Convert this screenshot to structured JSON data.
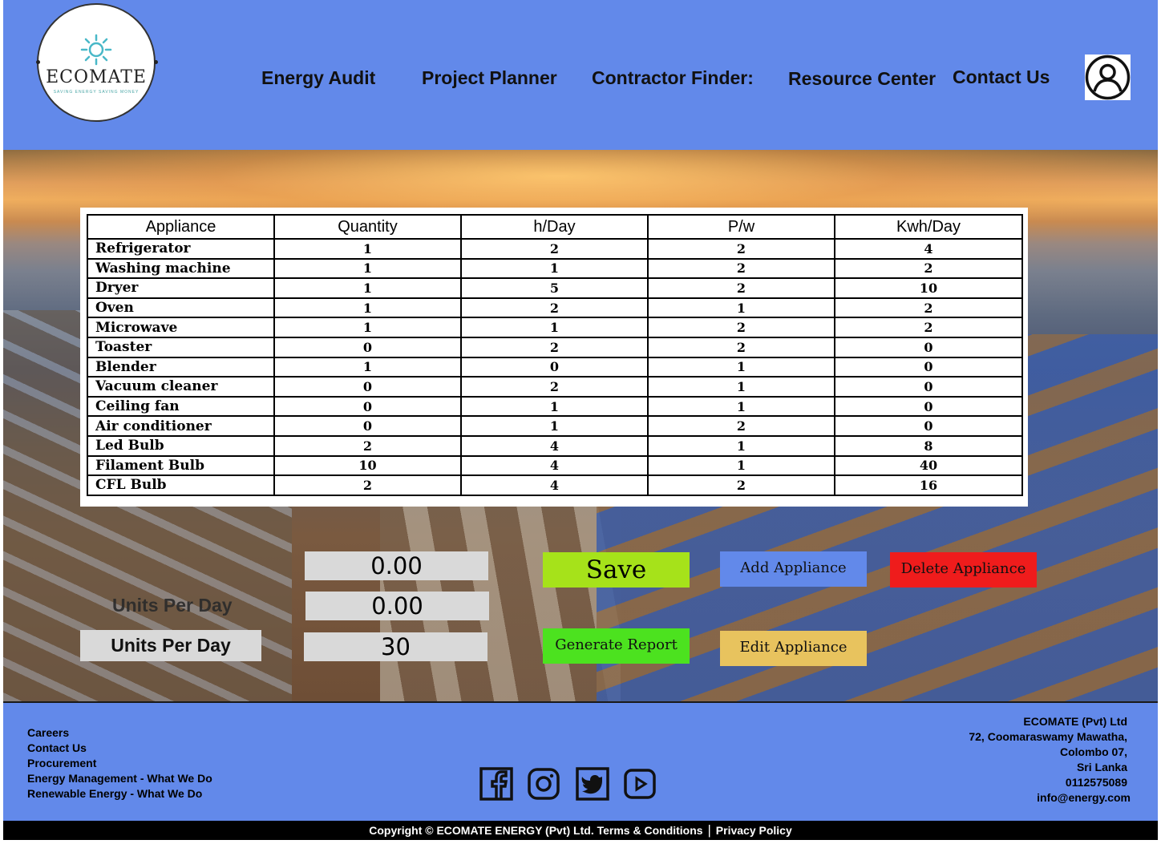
{
  "logo": {
    "brand": "ECOMATE",
    "tagline": "SAVING ENERGY SAVING MONEY"
  },
  "nav": {
    "energy_audit": "Energy Audit",
    "project_planner": "Project Planner",
    "contractor_finder": "Contractor Finder:",
    "resource_center": "Resource Center",
    "contact_us": "Contact Us"
  },
  "table": {
    "headers": [
      "Appliance",
      "Quantity",
      "h/Day",
      "P/w",
      "Kwh/Day"
    ],
    "rows": [
      [
        "Refrigerator",
        "1",
        "2",
        "2",
        "4"
      ],
      [
        "Washing machine",
        "1",
        "1",
        "2",
        "2"
      ],
      [
        "Dryer",
        "1",
        "5",
        "2",
        "10"
      ],
      [
        "Oven",
        "1",
        "2",
        "1",
        "2"
      ],
      [
        "Microwave",
        "1",
        "1",
        "2",
        "2"
      ],
      [
        "Toaster",
        "0",
        "2",
        "2",
        "0"
      ],
      [
        "Blender",
        "1",
        "0",
        "1",
        "0"
      ],
      [
        "Vacuum cleaner",
        "0",
        "2",
        "1",
        "0"
      ],
      [
        "Ceiling fan",
        "0",
        "1",
        "1",
        "0"
      ],
      [
        "Air conditioner",
        "0",
        "1",
        "2",
        "0"
      ],
      [
        "Led Bulb",
        "2",
        "4",
        "1",
        "8"
      ],
      [
        "Filament Bulb",
        "10",
        "4",
        "1",
        "40"
      ],
      [
        "CFL Bulb",
        "2",
        "4",
        "2",
        "16"
      ]
    ]
  },
  "controls": {
    "field1": "0.00",
    "field2": "0.00",
    "field3": "30",
    "ghost_label": "Units Per Day",
    "units_label": "Units Per Day",
    "save": "Save",
    "add_appliance": "Add Appliance",
    "delete_appliance": "Delete Appliance",
    "generate_report": "Generate Report",
    "edit_appliance": "Edit Appliance"
  },
  "footer": {
    "links": [
      "Careers",
      "Contact Us",
      "Procurement",
      "Energy Management - What We Do",
      "Renewable Energy - What We Do"
    ],
    "address": [
      "ECOMATE (Pvt) Ltd",
      "72, Coomaraswamy Mawatha,",
      "Colombo 07,",
      "Sri Lanka",
      "0112575089",
      "info@energy.com"
    ],
    "social": [
      "facebook-icon",
      "instagram-icon",
      "twitter-icon",
      "youtube-icon"
    ]
  },
  "bottom": {
    "copyright": "Copyright © ECOMATE ENERGY (Pvt) Ltd. Terms & Conditions",
    "separator": "|",
    "privacy": "Privacy Policy"
  },
  "colors": {
    "header_bg": "#6289ea",
    "save_btn": "#a6e21a",
    "generate_btn": "#4ce21f",
    "add_btn": "#6289ea",
    "delete_btn": "#ef1c1c",
    "edit_btn": "#e8c35e"
  }
}
